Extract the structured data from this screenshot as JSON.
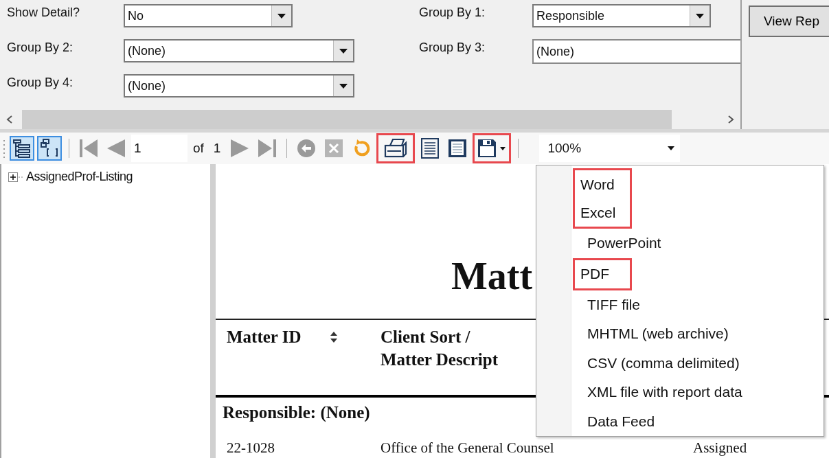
{
  "parameters": {
    "left": [
      {
        "label": "Show Detail?",
        "value": "No",
        "kind": "dropdown",
        "wide": false
      },
      {
        "label": "Group By 2:",
        "value": "(None)",
        "kind": "dropdown",
        "wide": true
      },
      {
        "label": "Group By 4:",
        "value": "(None)",
        "kind": "dropdown",
        "wide": true
      }
    ],
    "right": [
      {
        "label": "Group By 1:",
        "value": "Responsible",
        "kind": "dropdown",
        "wide": false
      },
      {
        "label": "Group By 3:",
        "value": "(None)",
        "kind": "field",
        "wide": true
      }
    ],
    "view_button": "View Rep"
  },
  "toolbar": {
    "tools": [
      {
        "kind": "tree",
        "selected": true,
        "highlighted": false
      },
      {
        "kind": "params",
        "selected": true,
        "highlighted": false
      },
      {
        "kind": "sep"
      },
      {
        "kind": "first",
        "selected": false,
        "highlighted": false
      },
      {
        "kind": "prev",
        "selected": false,
        "highlighted": false
      },
      {
        "kind": "page"
      },
      {
        "kind": "next",
        "selected": false,
        "highlighted": false
      },
      {
        "kind": "last",
        "selected": false,
        "highlighted": false
      },
      {
        "kind": "sep"
      },
      {
        "kind": "back",
        "selected": false,
        "highlighted": false
      },
      {
        "kind": "stop",
        "selected": false,
        "highlighted": false
      },
      {
        "kind": "refresh",
        "selected": false,
        "highlighted": false
      },
      {
        "kind": "print",
        "selected": false,
        "highlighted": true
      },
      {
        "kind": "layout",
        "selected": false,
        "highlighted": false
      },
      {
        "kind": "pagesetup",
        "selected": false,
        "highlighted": false
      },
      {
        "kind": "save",
        "selected": false,
        "highlighted": true
      },
      {
        "kind": "sep"
      },
      {
        "kind": "zoom"
      }
    ],
    "page": "1",
    "of": "of",
    "total": "1",
    "zoom": "100%"
  },
  "tree": [
    {
      "label": "AssignedProf-Listing",
      "expanded": false
    }
  ],
  "report": {
    "title": "Matt",
    "columns": [
      [
        "Matter ID"
      ],
      [
        "Client Sort /",
        "Matter Descript"
      ]
    ],
    "group": "Responsible: (None)",
    "row": [
      "22-1028",
      "Office of the General Counsel",
      "Assigned"
    ]
  },
  "export_menu": [
    {
      "label": "Word",
      "highlighted": true
    },
    {
      "label": "Excel",
      "highlighted": true
    },
    {
      "label": "PowerPoint",
      "highlighted": false
    },
    {
      "label": "PDF",
      "highlighted": true
    },
    {
      "label": "TIFF file",
      "highlighted": false
    },
    {
      "label": "MHTML (web archive)",
      "highlighted": false
    },
    {
      "label": "CSV (comma delimited)",
      "highlighted": false
    },
    {
      "label": "XML file with report data",
      "highlighted": false
    },
    {
      "label": "Data Feed",
      "highlighted": false
    }
  ]
}
